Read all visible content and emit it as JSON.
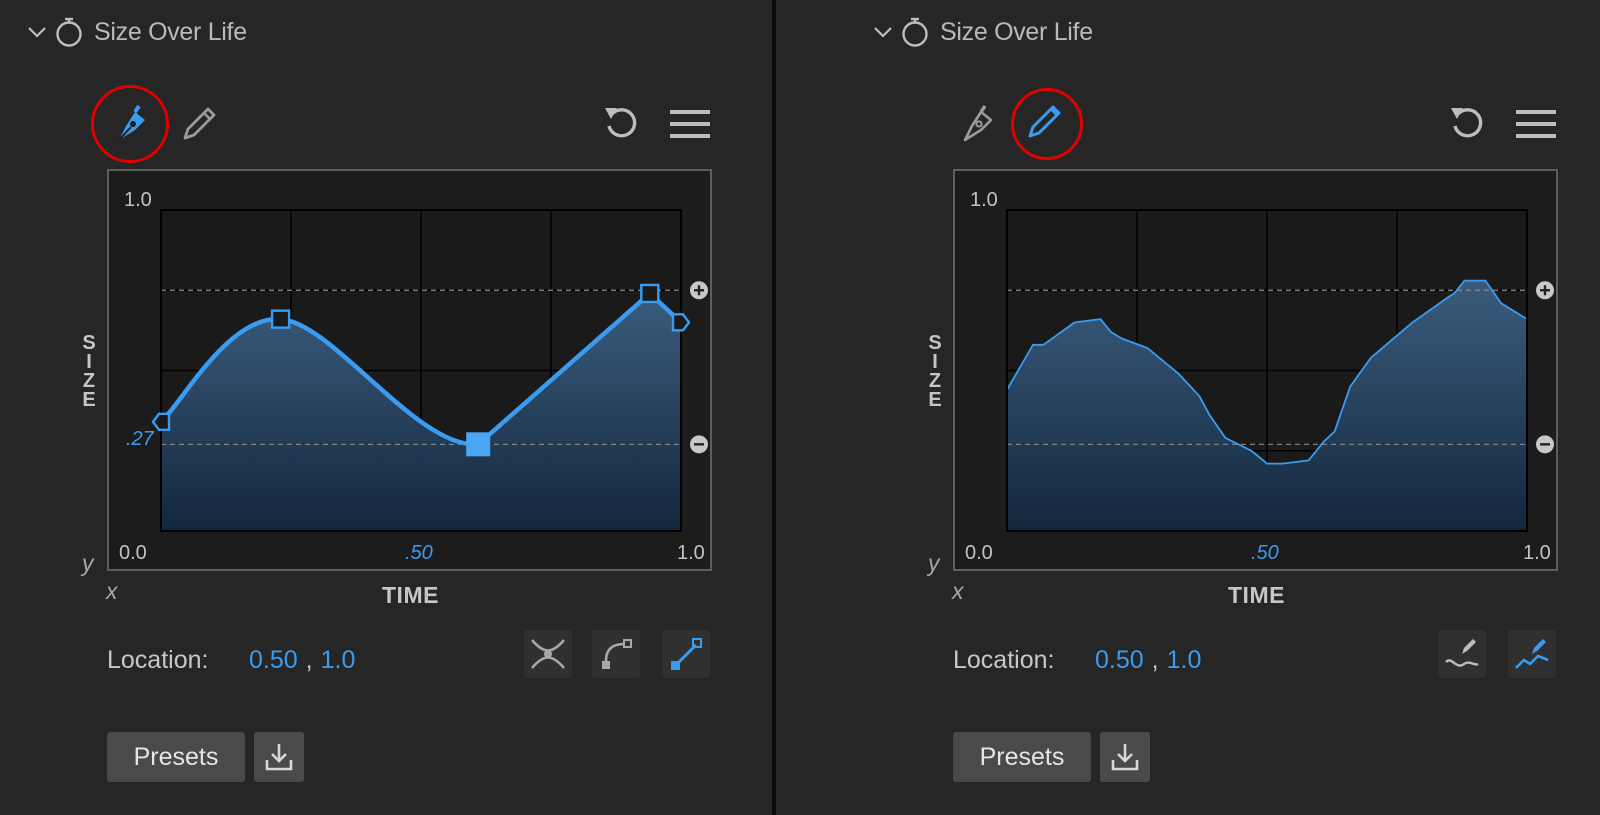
{
  "panels": [
    {
      "id": "left",
      "title": "Size Over Life",
      "tools": {
        "pen": "pen-tool-icon",
        "pencil": "pencil-tool-icon",
        "reset": "reset-icon",
        "menu": "menu-icon"
      },
      "active_tool": "pen",
      "axes": {
        "y_top": "1.0",
        "y_value": ".27",
        "x_min": "0.0",
        "x_mid": ".50",
        "x_max": "1.0",
        "x_axis": "TIME",
        "y_axis": "SIZE",
        "x_ind": "x",
        "y_ind": "y"
      },
      "location": {
        "label": "Location:",
        "x": "0.50",
        "sep": ",",
        "y": "1.0"
      },
      "mode_buttons": [
        {
          "icon": "bezier-curve-icon",
          "active": false
        },
        {
          "icon": "corner-point-icon",
          "active": false
        },
        {
          "icon": "linear-point-icon",
          "active": true
        }
      ],
      "presets_label": "Presets",
      "download_icon": "download-icon"
    },
    {
      "id": "right",
      "title": "Size Over Life",
      "tools": {
        "pen": "pen-tool-icon",
        "pencil": "pencil-tool-icon",
        "reset": "reset-icon",
        "menu": "menu-icon"
      },
      "active_tool": "pencil",
      "axes": {
        "y_top": "1.0",
        "x_min": "0.0",
        "x_mid": ".50",
        "x_max": "1.0",
        "x_axis": "TIME",
        "y_axis": "SIZE",
        "x_ind": "x",
        "y_ind": "y"
      },
      "location": {
        "label": "Location:",
        "x": "0.50",
        "sep": ",",
        "y": "1.0"
      },
      "mode_buttons": [
        {
          "icon": "freehand-smooth-icon",
          "active": false
        },
        {
          "icon": "freehand-linear-icon",
          "active": true
        }
      ],
      "presets_label": "Presets",
      "download_icon": "download-icon"
    }
  ],
  "colors": {
    "accent": "#3a9cf0",
    "highlight_ring": "#e00000",
    "background": "#262626"
  },
  "chart_data": [
    {
      "type": "area",
      "panel": "left",
      "x_range": [
        0,
        1
      ],
      "y_range": [
        0,
        1
      ],
      "control_points": [
        {
          "x": 0.0,
          "y": 0.34
        },
        {
          "x": 0.23,
          "y": 0.66
        },
        {
          "x": 0.61,
          "y": 0.27
        },
        {
          "x": 0.94,
          "y": 0.74
        },
        {
          "x": 1.0,
          "y": 0.65
        }
      ],
      "selected_point_index": 2,
      "guides": [
        0.75,
        0.27
      ]
    },
    {
      "type": "area",
      "panel": "right",
      "x_range": [
        0,
        1
      ],
      "y_range": [
        0,
        1
      ],
      "x": [
        0.0,
        0.05,
        0.07,
        0.13,
        0.18,
        0.2,
        0.22,
        0.27,
        0.33,
        0.37,
        0.39,
        0.42,
        0.47,
        0.5,
        0.53,
        0.58,
        0.61,
        0.63,
        0.66,
        0.7,
        0.78,
        0.85,
        0.86,
        0.88,
        0.92,
        0.95,
        1.0
      ],
      "values": [
        0.44,
        0.58,
        0.58,
        0.65,
        0.66,
        0.62,
        0.6,
        0.57,
        0.49,
        0.42,
        0.36,
        0.29,
        0.25,
        0.21,
        0.21,
        0.22,
        0.28,
        0.31,
        0.45,
        0.54,
        0.65,
        0.73,
        0.74,
        0.78,
        0.78,
        0.71,
        0.66
      ],
      "guides": [
        0.75,
        0.27
      ]
    }
  ]
}
